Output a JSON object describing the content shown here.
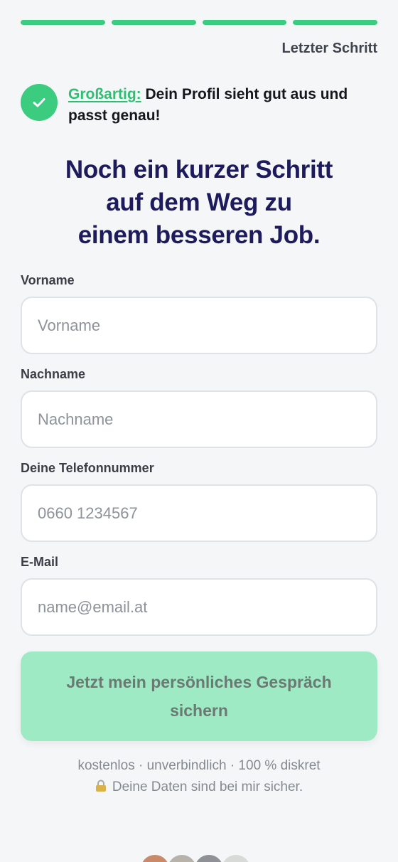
{
  "progress": {
    "total_steps": 4,
    "completed_steps": 4
  },
  "header": {
    "step_label": "Letzter Schritt"
  },
  "success": {
    "highlight": "Großartig:",
    "message": " Dein Profil sieht gut aus und passt genau!"
  },
  "headline": {
    "lines": [
      "Noch ein kurzer Schritt",
      "auf dem Weg zu",
      "einem besseren Job."
    ]
  },
  "form": {
    "first_name": {
      "label": "Vorname",
      "placeholder": "Vorname",
      "value": ""
    },
    "last_name": {
      "label": "Nachname",
      "placeholder": "Nachname",
      "value": ""
    },
    "phone": {
      "label": "Deine Telefonnummer",
      "placeholder": "0660 1234567",
      "value": ""
    },
    "email": {
      "label": "E-Mail",
      "placeholder": "name@email.at",
      "value": ""
    }
  },
  "cta": {
    "label": "Jetzt mein persönliches Gespräch sichern"
  },
  "footer": {
    "benefits": "kostenlos · unverbindlich · 100 % diskret",
    "privacy": "Deine Daten sind bei mir sicher.",
    "lock_icon": "lock-icon"
  },
  "avatars": {
    "count": 4,
    "colors": [
      "#c98a6a",
      "#b7b3ab",
      "#8e9196",
      "#d7dad6"
    ]
  },
  "colors": {
    "accent_green": "#3ccc80",
    "cta_disabled_bg": "#9eeac4",
    "headline_navy": "#1e1b5c",
    "background": "#f4f6f8"
  }
}
